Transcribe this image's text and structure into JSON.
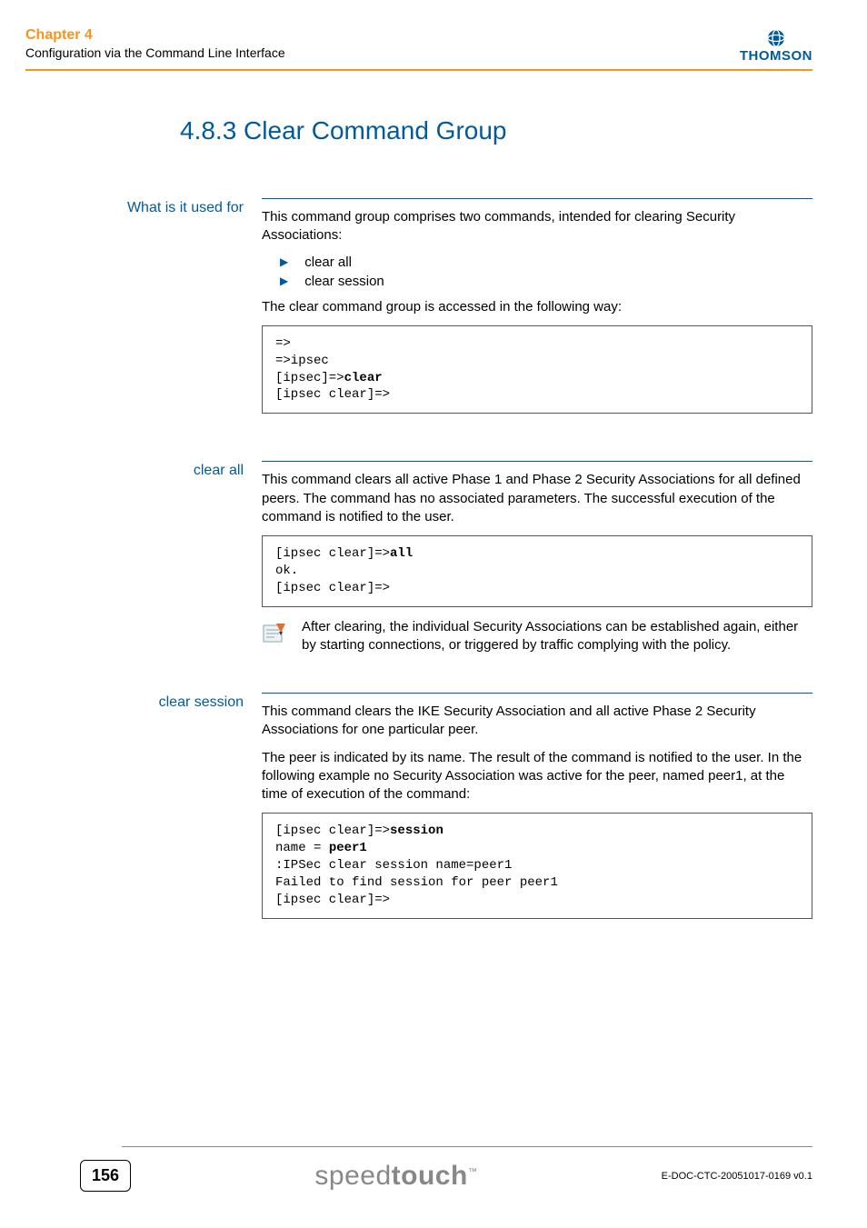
{
  "header": {
    "chapter": "Chapter 4",
    "subtitle": "Configuration via the Command Line Interface",
    "logo_text": "THOMSON"
  },
  "title": "4.8.3  Clear Command Group",
  "sections": {
    "used_for": {
      "label": "What is it used for",
      "intro": "This command group comprises two commands, intended for clearing Security Associations:",
      "bullets": [
        "clear all",
        "clear session"
      ],
      "access_text": "The clear command group is accessed in the following way:",
      "code_pre1": "=>\n=>ipsec\n[ipsec]=>",
      "code_bold1": "clear",
      "code_post1": "\n[ipsec clear]=>"
    },
    "clear_all": {
      "label": "clear all",
      "para": "This command clears all active Phase 1 and Phase 2 Security Associations for all defined peers. The command has no associated parameters. The successful execution of the command is notified to the user.",
      "code_pre": "[ipsec clear]=>",
      "code_bold": "all",
      "code_post": "\nok.\n[ipsec clear]=>",
      "note": "After clearing, the individual Security Associations can be established again, either by starting connections, or triggered by traffic complying with the policy."
    },
    "clear_session": {
      "label": "clear session",
      "para1": "This command clears the IKE Security Association and all active Phase 2 Security Associations for one particular peer.",
      "para2": "The peer is indicated by its name. The result of the command is notified to the user. In the following example no Security Association was active for the peer, named peer1, at the time of execution of the command:",
      "code_l1_pre": "[ipsec clear]=>",
      "code_l1_bold": "session",
      "code_l2_pre": "name = ",
      "code_l2_bold": "peer1",
      "code_rest": ":IPSec clear session name=peer1\nFailed to find session for peer peer1\n[ipsec clear]=>"
    }
  },
  "footer": {
    "page_number": "156",
    "brand_light": "speed",
    "brand_bold": "touch",
    "brand_tm": "™",
    "doc_id": "E-DOC-CTC-20051017-0169 v0.1"
  }
}
